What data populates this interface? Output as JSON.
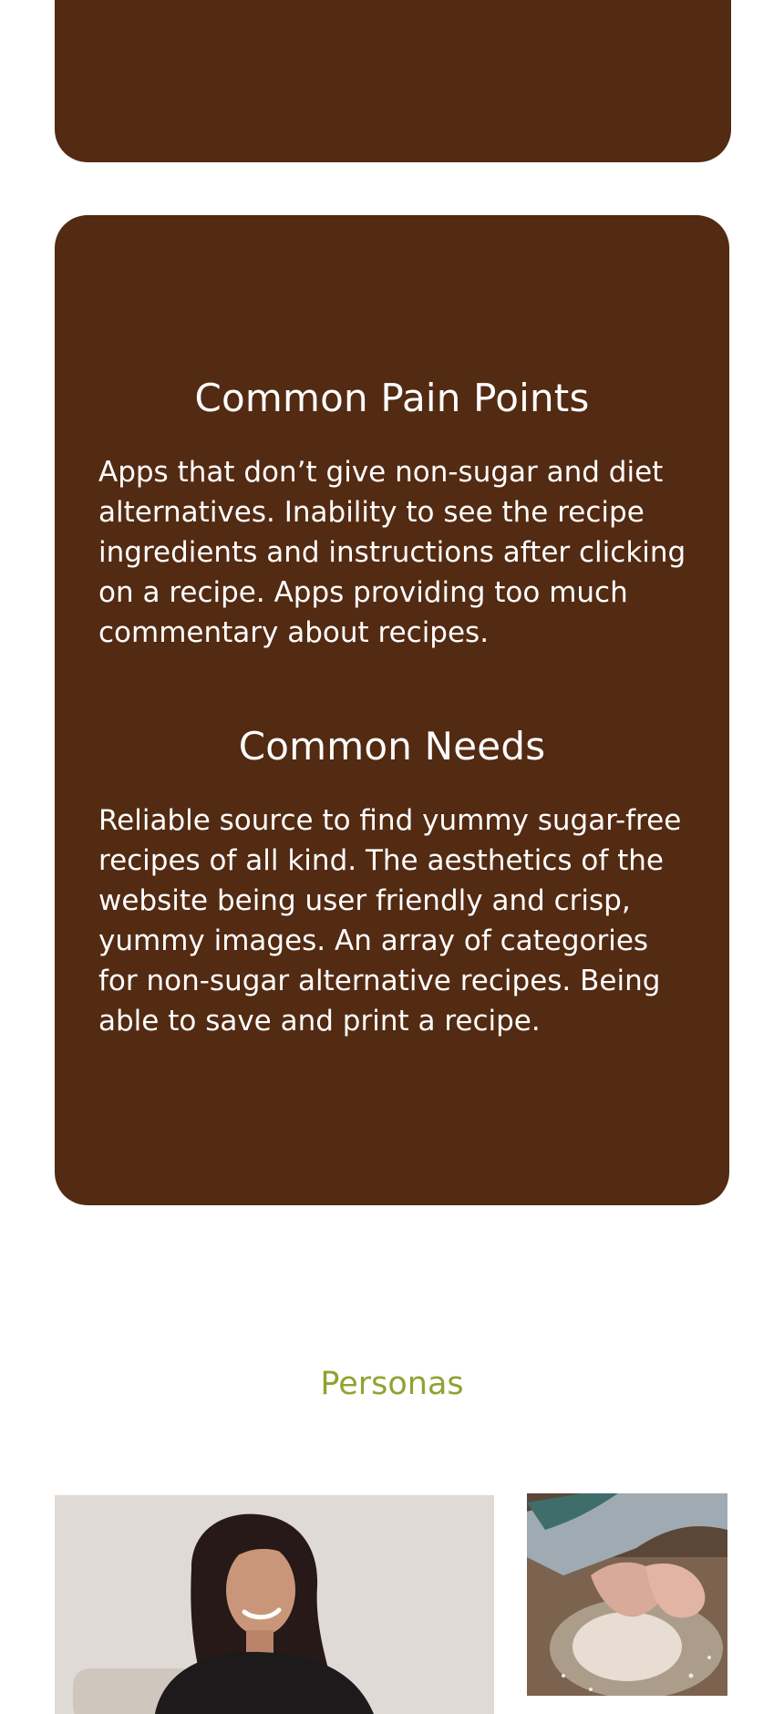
{
  "sections": {
    "pain_points": {
      "title": "Common Pain Points",
      "text": "Apps that don’t give non-sugar and diet alternatives. Inability to see the recipe ingredients and instructions after clicking on a recipe. Apps providing too much commentary about recipes."
    },
    "needs": {
      "title": "Common Needs",
      "text": "Reliable source to find yummy sugar-free recipes of all kind.  The aesthetics of the website being user friendly and crisp, yummy images. An array of categories for non-sugar alternative recipes. Being able to save and print a recipe."
    }
  },
  "personas": {
    "title": "Personas"
  },
  "colors": {
    "card_bg": "#532a12",
    "card_text": "#ffffff",
    "accent": "#8fa331",
    "page_bg": "#ffffff"
  }
}
